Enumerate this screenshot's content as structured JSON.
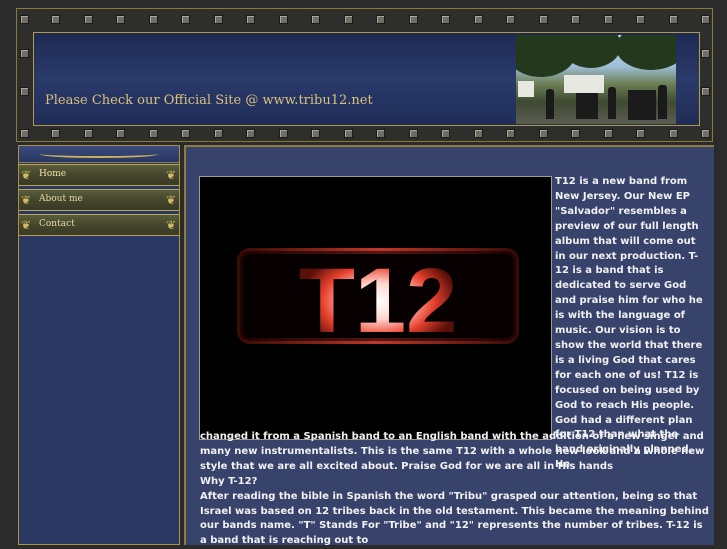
{
  "header": {
    "tagline": "Please Check our Official Site @ www.tribu12.net",
    "photo_icon": "band-photo"
  },
  "nav": {
    "items": [
      {
        "label": "Home",
        "active": true
      },
      {
        "label": "About me",
        "active": false
      },
      {
        "label": "Contact",
        "active": false
      }
    ]
  },
  "main": {
    "hero_text": "T12",
    "paragraph_side": "T12 is a new band from New Jersey. Our New EP \"Salvador\" resembles a preview of our full length album that will come out in our next production. T-12 is a band that is dedicated to serve God and praise him for who he is with the language of music. Our vision is to show the world that there is a living God that cares for each one of us! T12 is focused on being used by God to reach His people. God had a different plan for T12 than what the band originally planned, He",
    "paragraph_continue": "changed it from a Spanish band to an English band with the addition of a new singer and many new instrumentalists. This is the same T12 with a whole new look and a whole new style that we are all excited about. Praise God for we are all in His hands",
    "why_heading": "Why T-12?",
    "why_text": "After reading the bible in Spanish the word \"Tribu\" grasped our attention, being so that Israel was based on 12 tribes back in the old testament. This became the meaning behind our bands name. \"T\" Stands For \"Tribe\" and \"12\" represents the number of tribes. T-12 is a band that is reaching out to"
  },
  "colors": {
    "banner_blue": "#2a3a6a",
    "gold": "#d9c27a",
    "content_bg": "#38436b",
    "hero_red": "#e8412e"
  }
}
